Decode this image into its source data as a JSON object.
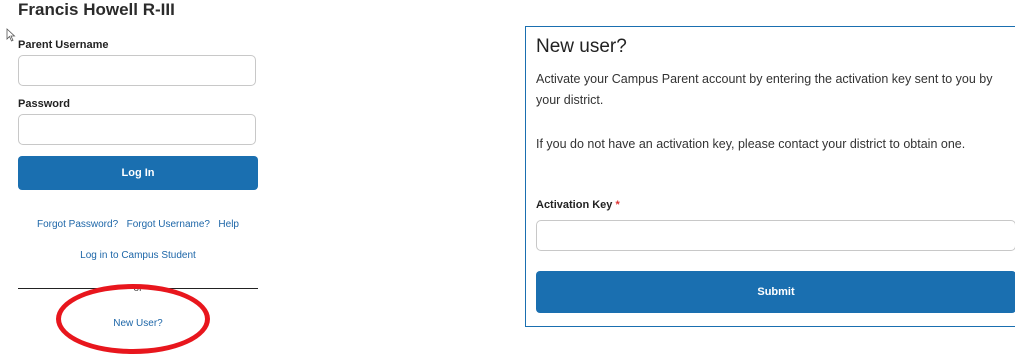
{
  "login": {
    "district_name": "Francis Howell R-III",
    "username_label": "Parent Username",
    "username_value": "",
    "password_label": "Password",
    "password_value": "",
    "login_button": "Log In",
    "forgot_password": "Forgot Password?",
    "forgot_username": "Forgot Username?",
    "help": "Help",
    "campus_student_link": "Log in to Campus Student",
    "or_text": "or",
    "new_user_link": "New User?"
  },
  "new_user_card": {
    "title": "New user?",
    "paragraph1": "Activate your Campus Parent account by entering the activation key sent to you by your district.",
    "paragraph2": "If you do not have an activation key, please contact your district to obtain one.",
    "activation_key_label": "Activation Key",
    "required_marker": "*",
    "activation_key_value": "",
    "submit_button": "Submit"
  },
  "colors": {
    "primary_button": "#1a6fb0",
    "link": "#1d66a8",
    "annotation_circle": "#e8161d"
  }
}
